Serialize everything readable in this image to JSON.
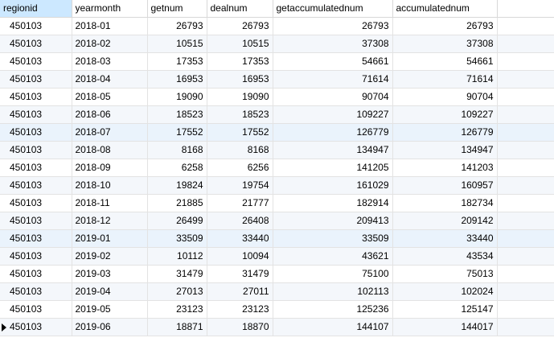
{
  "table": {
    "columns": [
      "regionid",
      "yearmonth",
      "getnum",
      "dealnum",
      "getaccumulatednum",
      "accumulatednum"
    ],
    "rows": [
      [
        "450103",
        "2018-01",
        "26793",
        "26793",
        "26793",
        "26793"
      ],
      [
        "450103",
        "2018-02",
        "10515",
        "10515",
        "37308",
        "37308"
      ],
      [
        "450103",
        "2018-03",
        "17353",
        "17353",
        "54661",
        "54661"
      ],
      [
        "450103",
        "2018-04",
        "16953",
        "16953",
        "71614",
        "71614"
      ],
      [
        "450103",
        "2018-05",
        "19090",
        "19090",
        "90704",
        "90704"
      ],
      [
        "450103",
        "2018-06",
        "18523",
        "18523",
        "109227",
        "109227"
      ],
      [
        "450103",
        "2018-07",
        "17552",
        "17552",
        "126779",
        "126779"
      ],
      [
        "450103",
        "2018-08",
        "8168",
        "8168",
        "134947",
        "134947"
      ],
      [
        "450103",
        "2018-09",
        "6258",
        "6256",
        "141205",
        "141203"
      ],
      [
        "450103",
        "2018-10",
        "19824",
        "19754",
        "161029",
        "160957"
      ],
      [
        "450103",
        "2018-11",
        "21885",
        "21777",
        "182914",
        "182734"
      ],
      [
        "450103",
        "2018-12",
        "26499",
        "26408",
        "209413",
        "209142"
      ],
      [
        "450103",
        "2019-01",
        "33509",
        "33440",
        "33509",
        "33440"
      ],
      [
        "450103",
        "2019-02",
        "10112",
        "10094",
        "43621",
        "43534"
      ],
      [
        "450103",
        "2019-03",
        "31479",
        "31479",
        "75100",
        "75013"
      ],
      [
        "450103",
        "2019-04",
        "27013",
        "27011",
        "102113",
        "102024"
      ],
      [
        "450103",
        "2019-05",
        "23123",
        "23123",
        "125236",
        "125147"
      ],
      [
        "450103",
        "2019-06",
        "18871",
        "18870",
        "144107",
        "144017"
      ]
    ],
    "current_row_index": 17,
    "selected_column": "regionid",
    "colors": {
      "selected_header": "#cce8ff",
      "grid_line": "#e3e3e3",
      "alt_row": "#f4f7fb"
    }
  }
}
